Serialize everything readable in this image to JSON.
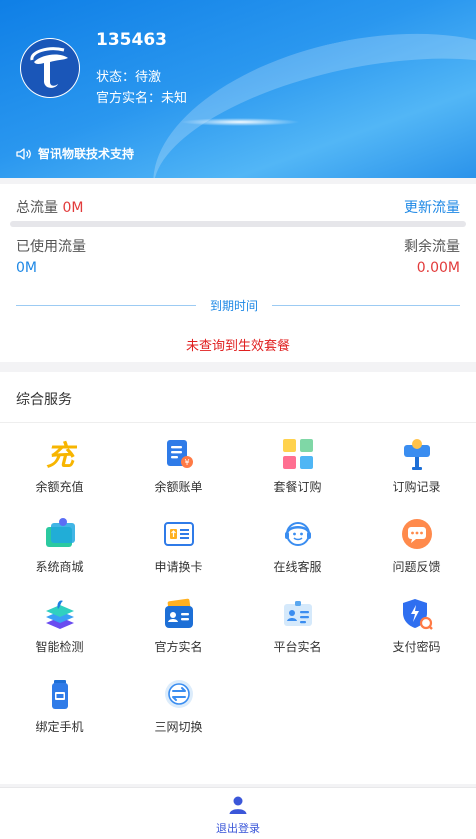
{
  "header": {
    "user_id": "135463",
    "status_line": "状态：待激",
    "realname_line": "官方实名：未知",
    "notice": "智讯物联技术支持"
  },
  "traffic": {
    "total_label": "总流量",
    "total_value": "0M",
    "refresh_label": "更新流量",
    "used_label": "已使用流量",
    "remaining_label": "剩余流量",
    "used_value": "0M",
    "remaining_value": "0.00M",
    "usage_fraction": 0,
    "expire_label": "到期时间",
    "no_plan_text": "未查询到生效套餐"
  },
  "services": {
    "title": "综合服务",
    "items": [
      {
        "label": "余额充值",
        "icon": "recharge-icon"
      },
      {
        "label": "余额账单",
        "icon": "bill-icon"
      },
      {
        "label": "套餐订购",
        "icon": "package-grid-icon"
      },
      {
        "label": "订购记录",
        "icon": "order-record-icon"
      },
      {
        "label": "系统商城",
        "icon": "mall-icon"
      },
      {
        "label": "申请换卡",
        "icon": "card-swap-icon"
      },
      {
        "label": "在线客服",
        "icon": "customer-service-icon"
      },
      {
        "label": "问题反馈",
        "icon": "feedback-icon"
      },
      {
        "label": "智能检测",
        "icon": "smart-detect-icon"
      },
      {
        "label": "官方实名",
        "icon": "official-realname-icon"
      },
      {
        "label": "平台实名",
        "icon": "platform-realname-icon"
      },
      {
        "label": "支付密码",
        "icon": "pay-password-icon"
      },
      {
        "label": "绑定手机",
        "icon": "bind-phone-icon"
      },
      {
        "label": "三网切换",
        "icon": "network-switch-icon"
      }
    ]
  },
  "bottom": {
    "logout_label": "退出登录"
  },
  "colors": {
    "accent_blue": "#1e88e5",
    "alert_red": "#e23b3b",
    "logout_blue": "#3b57d9"
  }
}
